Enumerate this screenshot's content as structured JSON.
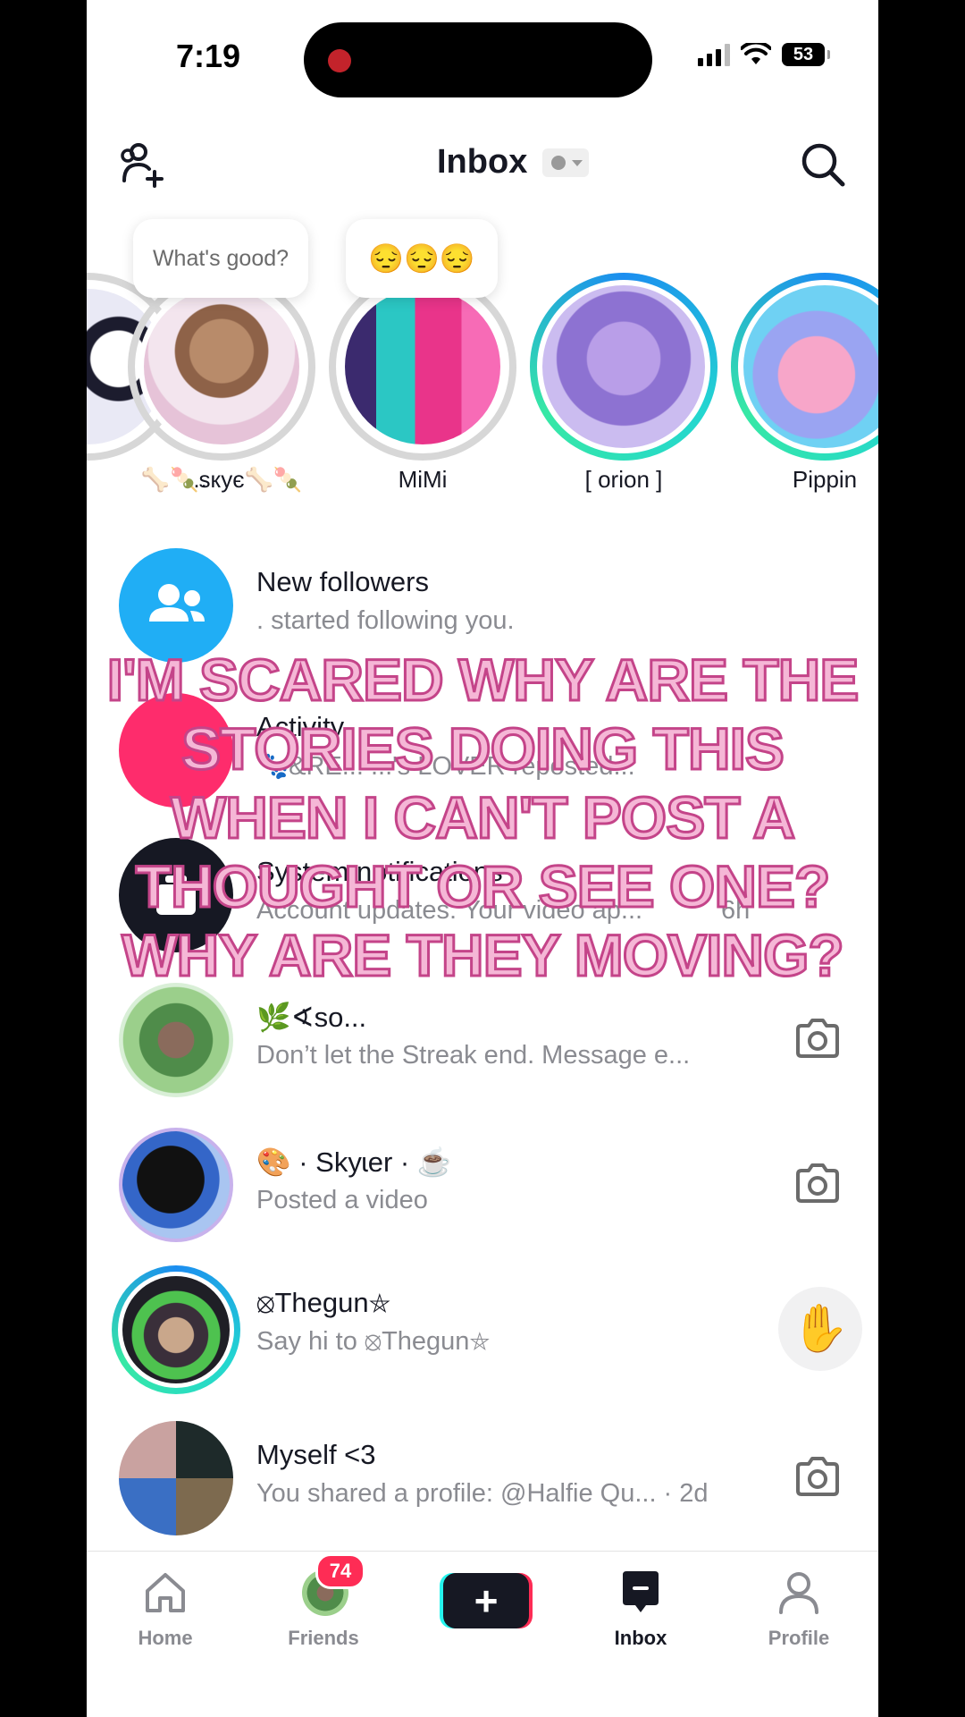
{
  "status_bar": {
    "time": "7:19",
    "battery": "53"
  },
  "header": {
    "title": "Inbox"
  },
  "stories": [
    {
      "name": "…"
    },
    {
      "name": "🦴🍡sкує🦴🍡",
      "note": "What's good?"
    },
    {
      "name": "MiMi",
      "note": "😔😔😔"
    },
    {
      "name": "[ orion ]"
    },
    {
      "name": "Pippin"
    }
  ],
  "rows": [
    {
      "title": "New followers",
      "subtitle": ". started following you."
    },
    {
      "title": "Activity",
      "subtitle": "🐾&RE... ...'s LOVER reposted..."
    },
    {
      "title": "System notifications",
      "subtitle": "Account updates: Your video ap...",
      "meta": "6h"
    },
    {
      "title": "🌿∢so...",
      "subtitle": "Don’t let the Streak end. Message e..."
    },
    {
      "title": "🎨 · Skyɩer · ☕",
      "subtitle": "Posted a video"
    },
    {
      "title": "⦻Thegun⛤",
      "subtitle": "Say hi to ⦻Thegun⛤"
    },
    {
      "title": "Myself  <3",
      "subtitle": "You shared a profile: @Halfie Qu... · 2d"
    }
  ],
  "caption": "I'M SCARED WHY ARE THE STORIES DOING THIS WHEN I CAN'T POST A THOUGHT OR SEE ONE? WHY ARE THEY MOVING?",
  "nav": {
    "home": "Home",
    "friends": "Friends",
    "friends_badge": "74",
    "inbox": "Inbox",
    "profile": "Profile"
  },
  "colors": {
    "accent_red": "#fe2c55",
    "accent_cyan": "#25f4ee",
    "followers_blue": "#20aef5",
    "activity_pink": "#fe2c6c",
    "system_dark": "#161823"
  }
}
